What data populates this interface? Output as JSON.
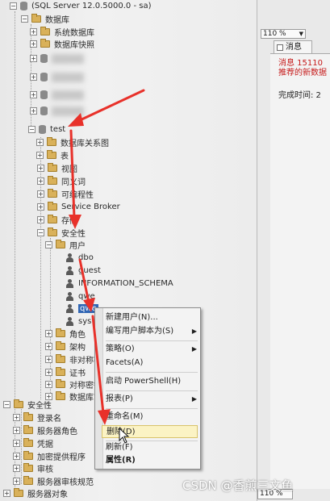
{
  "server_node": "(SQL Server 12.0.5000.0 - sa)",
  "tree": {
    "databases": "数据库",
    "system_databases": "系统数据库",
    "database_snapshots": "数据库快照",
    "test_db": "test",
    "test_children": {
      "diagrams": "数据库关系图",
      "tables": "表",
      "views": "视图",
      "synonyms": "同义词",
      "programmability": "可编程性",
      "service_broker": "Service Broker",
      "storage": "存储",
      "security": "安全性",
      "users": "用户",
      "user_list": [
        "dbo",
        "guest",
        "INFORMATION_SCHEMA",
        "qwe",
        "qwe",
        "sys"
      ],
      "roles": "角色",
      "schemas": "架构",
      "asym_keys": "非对称密钥",
      "certificates": "证书",
      "sym_keys": "对称密钥",
      "db_audit": "数据库审"
    },
    "server_security": "安全性",
    "server_security_children": {
      "logins": "登录名",
      "server_roles": "服务器角色",
      "credentials": "凭据",
      "crypto_providers": "加密提供程序",
      "audits": "审核",
      "audit_specs": "服务器审核规范"
    },
    "server_objects": "服务器对象"
  },
  "context_menu": {
    "items": [
      {
        "label": "新建用户(N)..."
      },
      {
        "label": "编写用户脚本为(S)"
      },
      {
        "label": "策略(O)"
      },
      {
        "label": "Facets(A)"
      },
      {
        "label": "启动 PowerShell(H)"
      },
      {
        "label": "报表(P)"
      },
      {
        "label": "重命名(M)"
      },
      {
        "label": "删除(D)"
      },
      {
        "label": "刷新(F)"
      },
      {
        "label": "属性(R)"
      }
    ]
  },
  "right_pane": {
    "zoom": "110 %",
    "messages_tab": "消息",
    "error_line1": "消息 15110",
    "error_line2": "推荐的新数据",
    "completion": "完成时间: 2",
    "zoom_bottom": "110 %"
  },
  "watermark": "CSDN @香煎三文鱼",
  "colors": {
    "selection": "#3166b4",
    "arrow": "#e8312a",
    "highlight_item": "#fbf3c4",
    "error_text": "#c61a1a"
  }
}
